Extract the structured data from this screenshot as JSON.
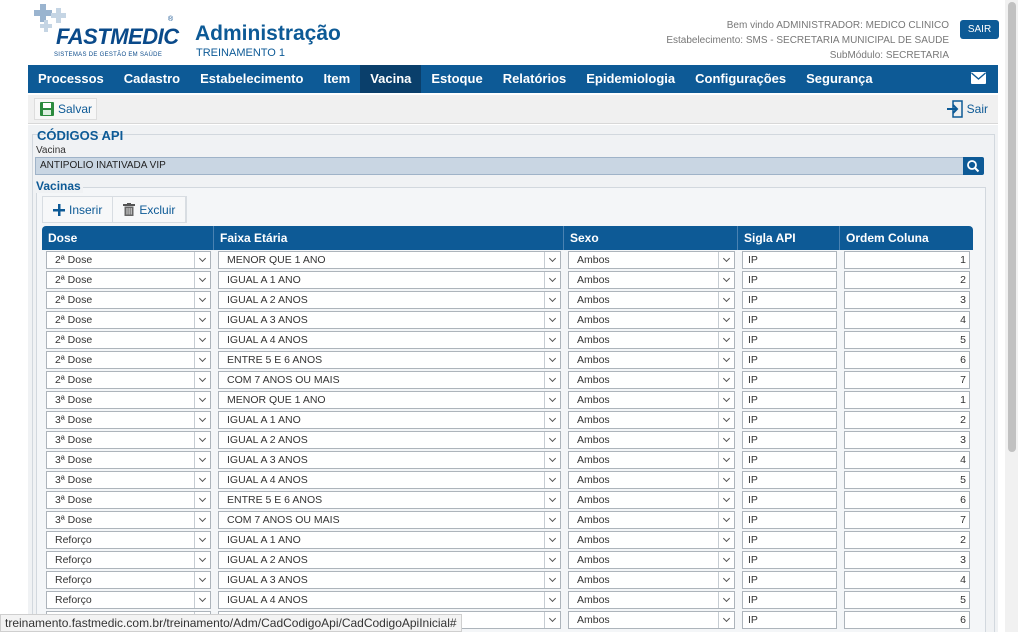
{
  "header": {
    "brand": "FASTMEDIC",
    "brand_tagline": "SISTEMAS DE GESTÃO EM SAÚDE",
    "title": "Administração",
    "subtitle": "TREINAMENTO 1",
    "welcome": "Bem vindo ADMINISTRADOR: MEDICO CLINICO",
    "establishment": "Estabelecimento: SMS - SECRETARIA MUNICIPAL DE SAUDE",
    "submodule": "SubMódulo: SECRETARIA",
    "logout_label": "SAIR"
  },
  "nav": {
    "items": [
      "Processos",
      "Cadastro",
      "Estabelecimento",
      "Item",
      "Vacina",
      "Estoque",
      "Relatórios",
      "Epidemiologia",
      "Configurações",
      "Segurança"
    ],
    "active": "Vacina"
  },
  "toolbar": {
    "save_label": "Salvar",
    "exit_label": "Sair"
  },
  "page": {
    "title": "CÓDIGOS API",
    "vaccine_label": "Vacina",
    "vaccine_value": "ANTIPOLIO INATIVADA VIP",
    "section_title": "Vacinas",
    "insert_label": "Inserir",
    "delete_label": "Excluir"
  },
  "grid": {
    "columns": [
      "Dose",
      "Faixa Etária",
      "Sexo",
      "Sigla API",
      "Ordem Coluna"
    ],
    "rows": [
      {
        "dose": "2ª Dose",
        "faixa": "MENOR QUE 1 ANO",
        "sexo": "Ambos",
        "sigla": "IP",
        "ordem": "1"
      },
      {
        "dose": "2ª Dose",
        "faixa": "IGUAL A 1 ANO",
        "sexo": "Ambos",
        "sigla": "IP",
        "ordem": "2"
      },
      {
        "dose": "2ª Dose",
        "faixa": "IGUAL A 2 ANOS",
        "sexo": "Ambos",
        "sigla": "IP",
        "ordem": "3"
      },
      {
        "dose": "2ª Dose",
        "faixa": "IGUAL A 3 ANOS",
        "sexo": "Ambos",
        "sigla": "IP",
        "ordem": "4"
      },
      {
        "dose": "2ª Dose",
        "faixa": "IGUAL A 4 ANOS",
        "sexo": "Ambos",
        "sigla": "IP",
        "ordem": "5"
      },
      {
        "dose": "2ª Dose",
        "faixa": "ENTRE 5 E 6 ANOS",
        "sexo": "Ambos",
        "sigla": "IP",
        "ordem": "6"
      },
      {
        "dose": "2ª Dose",
        "faixa": "COM 7 ANOS OU MAIS",
        "sexo": "Ambos",
        "sigla": "IP",
        "ordem": "7"
      },
      {
        "dose": "3ª Dose",
        "faixa": "MENOR QUE 1 ANO",
        "sexo": "Ambos",
        "sigla": "IP",
        "ordem": "1"
      },
      {
        "dose": "3ª Dose",
        "faixa": "IGUAL A 1 ANO",
        "sexo": "Ambos",
        "sigla": "IP",
        "ordem": "2"
      },
      {
        "dose": "3ª Dose",
        "faixa": "IGUAL A 2 ANOS",
        "sexo": "Ambos",
        "sigla": "IP",
        "ordem": "3"
      },
      {
        "dose": "3ª Dose",
        "faixa": "IGUAL A 3 ANOS",
        "sexo": "Ambos",
        "sigla": "IP",
        "ordem": "4"
      },
      {
        "dose": "3ª Dose",
        "faixa": "IGUAL A 4 ANOS",
        "sexo": "Ambos",
        "sigla": "IP",
        "ordem": "5"
      },
      {
        "dose": "3ª Dose",
        "faixa": "ENTRE 5 E 6 ANOS",
        "sexo": "Ambos",
        "sigla": "IP",
        "ordem": "6"
      },
      {
        "dose": "3ª Dose",
        "faixa": "COM 7 ANOS OU MAIS",
        "sexo": "Ambos",
        "sigla": "IP",
        "ordem": "7"
      },
      {
        "dose": "Reforço",
        "faixa": "IGUAL A 1 ANO",
        "sexo": "Ambos",
        "sigla": "IP",
        "ordem": "2"
      },
      {
        "dose": "Reforço",
        "faixa": "IGUAL A 2 ANOS",
        "sexo": "Ambos",
        "sigla": "IP",
        "ordem": "3"
      },
      {
        "dose": "Reforço",
        "faixa": "IGUAL A 3 ANOS",
        "sexo": "Ambos",
        "sigla": "IP",
        "ordem": "4"
      },
      {
        "dose": "Reforço",
        "faixa": "IGUAL A 4 ANOS",
        "sexo": "Ambos",
        "sigla": "IP",
        "ordem": "5"
      },
      {
        "dose": "",
        "faixa": "",
        "sexo": "Ambos",
        "sigla": "IP",
        "ordem": "6"
      }
    ]
  },
  "status_url": "treinamento.fastmedic.com.br/treinamento/Adm/CadCodigoApi/CadCodigoApiInicial#",
  "colors": {
    "primary": "#0d5a96",
    "nav_active": "#0a3f6b",
    "input_readonly": "#c9d6e3"
  }
}
